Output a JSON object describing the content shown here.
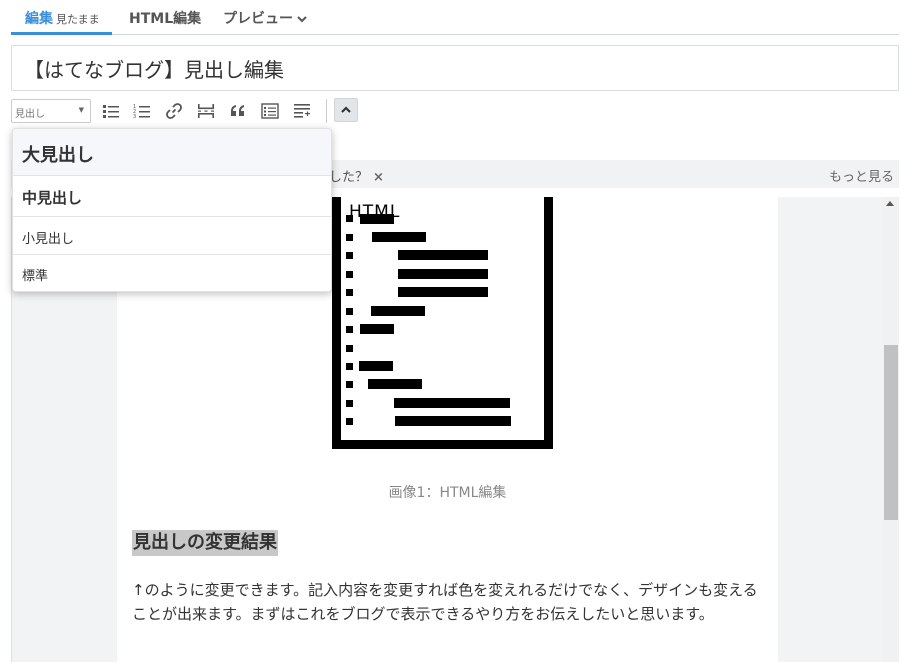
{
  "tabs": {
    "edit_label": "編集",
    "edit_mode": "見たまま",
    "html_label": "HTML編集",
    "preview_label": "プレビュー"
  },
  "title": {
    "value": "【はてなブログ】見出し編集"
  },
  "toolbar": {
    "format_select": "見出し",
    "buttons": [
      "unordered-list",
      "ordered-list",
      "link",
      "read-more",
      "blockquote",
      "table-of-contents",
      "footnote"
    ]
  },
  "infobar": {
    "message_fragment": "した？",
    "close_glyph": "×",
    "more_label": "もっと見る"
  },
  "dropdown": {
    "items": [
      "大見出し",
      "中見出し",
      "小見出し",
      "標準"
    ]
  },
  "document": {
    "figure_label": "HTML",
    "caption": "画像1：HTML編集",
    "heading": "見出しの変更結果",
    "paragraph": "↑のように変更できます。記入内容を変更すれば色を変えれるだけでなく、デザインも変えることが出来ます。まずはこれをブログで表示できるやり方をお伝えしたいと思います。"
  },
  "colors": {
    "accent": "#3b8fd9",
    "toolbar_icon": "#555555",
    "heading_highlight": "#c8c8c8"
  }
}
